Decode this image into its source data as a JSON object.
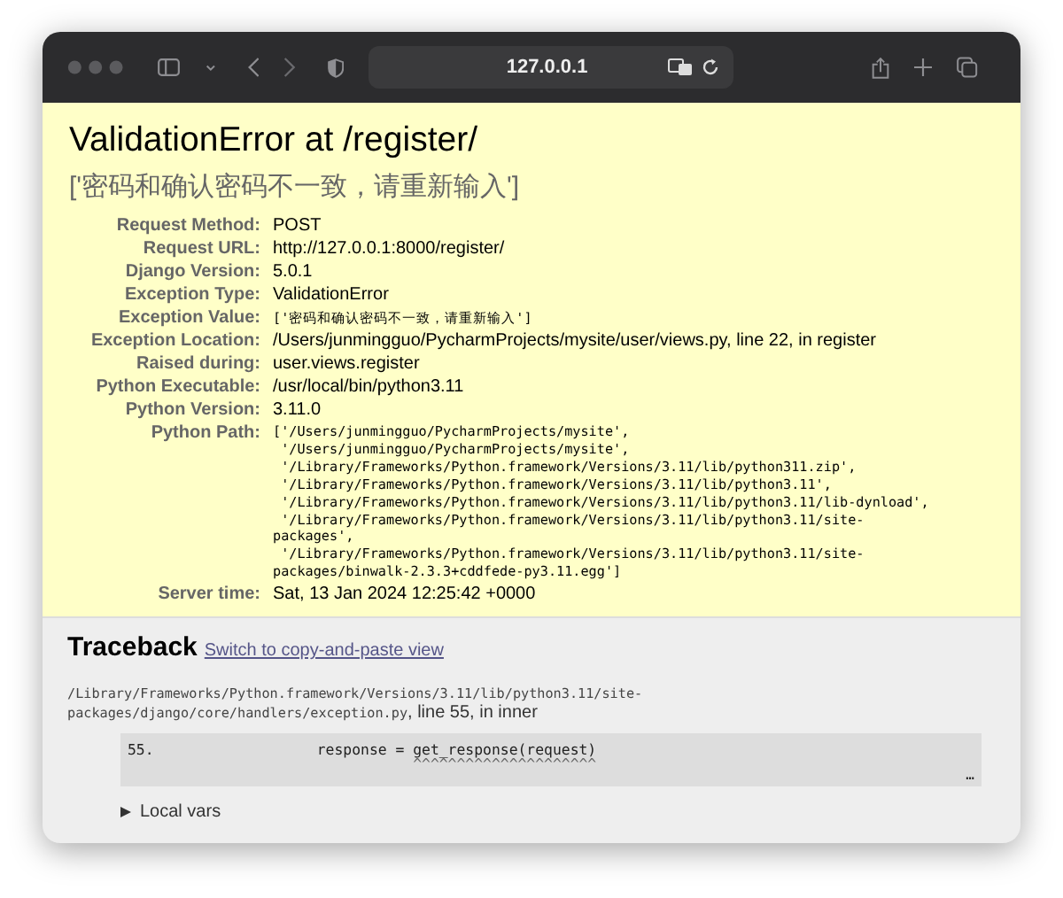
{
  "browser": {
    "address": "127.0.0.1"
  },
  "error": {
    "title": "ValidationError at /register/",
    "subtitle": "['密码和确认密码不一致，请重新输入']"
  },
  "summary": [
    {
      "label": "Request Method:",
      "value": "POST",
      "kind": "text"
    },
    {
      "label": "Request URL:",
      "value": "http://127.0.0.1:8000/register/",
      "kind": "text"
    },
    {
      "label": "Django Version:",
      "value": "5.0.1",
      "kind": "text"
    },
    {
      "label": "Exception Type:",
      "value": "ValidationError",
      "kind": "text"
    },
    {
      "label": "Exception Value:",
      "value": "['密码和确认密码不一致，请重新输入']",
      "kind": "code"
    },
    {
      "label": "Exception Location:",
      "value": "/Users/junmingguo/PycharmProjects/mysite/user/views.py, line 22, in register",
      "kind": "text"
    },
    {
      "label": "Raised during:",
      "value": "user.views.register",
      "kind": "text"
    },
    {
      "label": "Python Executable:",
      "value": "/usr/local/bin/python3.11",
      "kind": "text"
    },
    {
      "label": "Python Version:",
      "value": "3.11.0",
      "kind": "text"
    },
    {
      "label": "Python Path:",
      "lines": [
        "['/Users/junmingguo/PycharmProjects/mysite',",
        " '/Users/junmingguo/PycharmProjects/mysite',",
        " '/Library/Frameworks/Python.framework/Versions/3.11/lib/python311.zip',",
        " '/Library/Frameworks/Python.framework/Versions/3.11/lib/python3.11',",
        " '/Library/Frameworks/Python.framework/Versions/3.11/lib/python3.11/lib-dynload',",
        " '/Library/Frameworks/Python.framework/Versions/3.11/lib/python3.11/site-",
        "packages',",
        " '/Library/Frameworks/Python.framework/Versions/3.11/lib/python3.11/site-",
        "packages/binwalk-2.3.3+cddfede-py3.11.egg']"
      ],
      "kind": "lines"
    },
    {
      "label": "Server time:",
      "value": "Sat, 13 Jan 2024 12:25:42 +0000",
      "kind": "text"
    }
  ],
  "traceback": {
    "title": "Traceback",
    "link": "Switch to copy-and-paste view",
    "frames": [
      {
        "path_lines": [
          "/Library/Frameworks/Python.framework/Versions/3.11/lib/python3.11/site-",
          "packages/django/core/handlers/exception.py"
        ],
        "where": ", line 55, in inner",
        "line_number": "55.",
        "code": "                response = get_response(request)",
        "carets": "                           ^^^^^^^^^^^^^^^^^^^^^",
        "more": "…",
        "local_vars": "Local vars",
        "expanded": false
      }
    ]
  }
}
